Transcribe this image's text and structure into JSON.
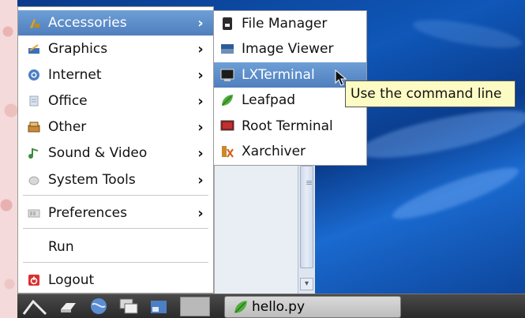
{
  "main_menu": {
    "items": [
      {
        "label": "Accessories",
        "icon": "accessories-icon",
        "has_submenu": true,
        "selected": true
      },
      {
        "label": "Graphics",
        "icon": "graphics-icon",
        "has_submenu": true
      },
      {
        "label": "Internet",
        "icon": "internet-globe-icon",
        "has_submenu": true
      },
      {
        "label": "Office",
        "icon": "office-icon",
        "has_submenu": true
      },
      {
        "label": "Other",
        "icon": "other-icon",
        "has_submenu": true
      },
      {
        "label": "Sound & Video",
        "icon": "sound-video-icon",
        "has_submenu": true
      },
      {
        "label": "System Tools",
        "icon": "system-tools-icon",
        "has_submenu": true
      },
      {
        "label": "Preferences",
        "icon": "preferences-icon",
        "has_submenu": true
      },
      {
        "label": "Run",
        "icon": "",
        "has_submenu": false
      },
      {
        "label": "Logout",
        "icon": "logout-icon",
        "has_submenu": false
      }
    ]
  },
  "submenu": {
    "items": [
      {
        "label": "File Manager",
        "icon": "file-manager-icon"
      },
      {
        "label": "Image Viewer",
        "icon": "image-viewer-icon"
      },
      {
        "label": "LXTerminal",
        "icon": "terminal-icon",
        "selected": true
      },
      {
        "label": "Leafpad",
        "icon": "leafpad-icon"
      },
      {
        "label": "Root Terminal",
        "icon": "root-terminal-icon"
      },
      {
        "label": "Xarchiver",
        "icon": "xarchiver-icon"
      }
    ]
  },
  "tooltip": {
    "text": "Use the command line"
  },
  "taskbar": {
    "task_label": "hello.py"
  },
  "colors": {
    "highlight": "#5a8ac8",
    "desktop": "#0f57b8",
    "tooltip_bg": "#fdfbc4"
  }
}
